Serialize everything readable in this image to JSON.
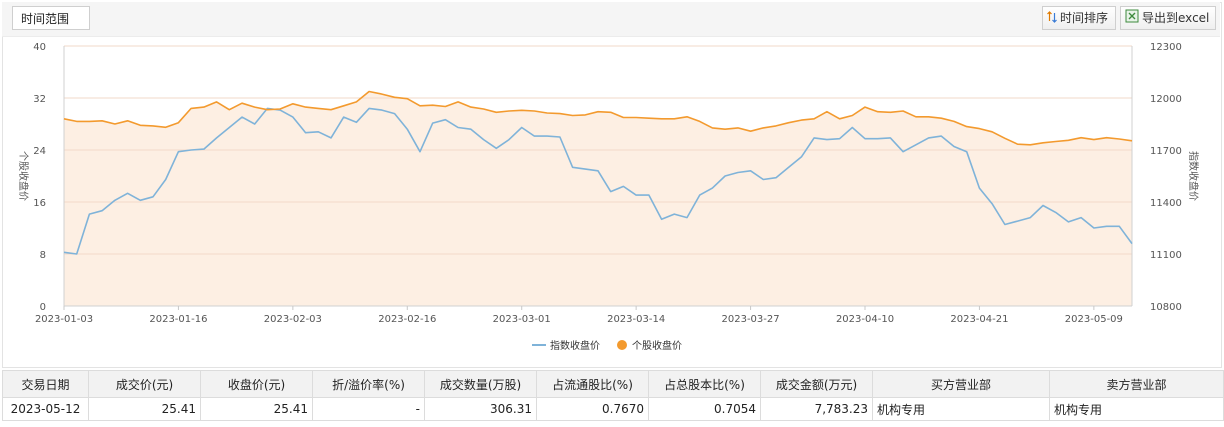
{
  "toolbar": {
    "range_label": "时间范围",
    "sort_label": "时间排序",
    "export_label": "导出到excel"
  },
  "chart_data": {
    "type": "line",
    "x": [
      "2023-01-03",
      "2023-01-04",
      "2023-01-05",
      "2023-01-06",
      "2023-01-09",
      "2023-01-10",
      "2023-01-11",
      "2023-01-12",
      "2023-01-13",
      "2023-01-16",
      "2023-01-17",
      "2023-01-18",
      "2023-01-19",
      "2023-01-20",
      "2023-01-30",
      "2023-01-31",
      "2023-02-01",
      "2023-02-02",
      "2023-02-03",
      "2023-02-06",
      "2023-02-07",
      "2023-02-08",
      "2023-02-09",
      "2023-02-10",
      "2023-02-13",
      "2023-02-14",
      "2023-02-15",
      "2023-02-16",
      "2023-02-17",
      "2023-02-20",
      "2023-02-21",
      "2023-02-22",
      "2023-02-23",
      "2023-02-24",
      "2023-02-27",
      "2023-02-28",
      "2023-03-01",
      "2023-03-02",
      "2023-03-03",
      "2023-03-06",
      "2023-03-07",
      "2023-03-08",
      "2023-03-09",
      "2023-03-10",
      "2023-03-13",
      "2023-03-14",
      "2023-03-15",
      "2023-03-16",
      "2023-03-17",
      "2023-03-20",
      "2023-03-21",
      "2023-03-22",
      "2023-03-23",
      "2023-03-24",
      "2023-03-27",
      "2023-03-28",
      "2023-03-29",
      "2023-03-30",
      "2023-03-31",
      "2023-04-03",
      "2023-04-04",
      "2023-04-06",
      "2023-04-07",
      "2023-04-10",
      "2023-04-11",
      "2023-04-12",
      "2023-04-13",
      "2023-04-14",
      "2023-04-17",
      "2023-04-18",
      "2023-04-19",
      "2023-04-20",
      "2023-04-21",
      "2023-04-24",
      "2023-04-25",
      "2023-04-26",
      "2023-04-27",
      "2023-04-28",
      "2023-05-04",
      "2023-05-05",
      "2023-05-08",
      "2023-05-09",
      "2023-05-10",
      "2023-05-11",
      "2023-05-12"
    ],
    "series": [
      {
        "name": "指数收盘价",
        "axis": "right",
        "color": "#7fb3d9",
        "values": [
          11110,
          11100,
          11330,
          11350,
          11410,
          11450,
          11410,
          11430,
          11530,
          11690,
          11700,
          11705,
          11770,
          11830,
          11890,
          11850,
          11940,
          11930,
          11890,
          11800,
          11805,
          11770,
          11890,
          11860,
          11940,
          11930,
          11910,
          11820,
          11690,
          11855,
          11875,
          11830,
          11820,
          11760,
          11710,
          11760,
          11830,
          11780,
          11780,
          11775,
          11600,
          11590,
          11580,
          11460,
          11490,
          11440,
          11440,
          11300,
          11330,
          11310,
          11440,
          11480,
          11550,
          11570,
          11580,
          11530,
          11540,
          11600,
          11660,
          11770,
          11760,
          11765,
          11830,
          11765,
          11765,
          11770,
          11690,
          11730,
          11770,
          11780,
          11720,
          11690,
          11480,
          11390,
          11270,
          11290,
          11310,
          11380,
          11340,
          11285,
          11310,
          11250,
          11260,
          11260,
          11160
        ]
      },
      {
        "name": "个股收盘价",
        "axis": "left",
        "color": "#f39a2e",
        "values": [
          28.8,
          28.4,
          28.4,
          28.5,
          28.0,
          28.5,
          27.8,
          27.7,
          27.5,
          28.2,
          30.4,
          30.6,
          31.4,
          30.2,
          31.2,
          30.6,
          30.2,
          30.3,
          31.1,
          30.6,
          30.4,
          30.2,
          30.8,
          31.4,
          33.0,
          32.6,
          32.1,
          31.9,
          30.8,
          30.9,
          30.7,
          31.4,
          30.6,
          30.3,
          29.8,
          30.0,
          30.1,
          30.0,
          29.7,
          29.6,
          29.3,
          29.4,
          29.9,
          29.8,
          29.0,
          29.0,
          28.9,
          28.8,
          28.8,
          29.1,
          28.4,
          27.4,
          27.2,
          27.4,
          26.9,
          27.4,
          27.7,
          28.2,
          28.6,
          28.8,
          29.9,
          28.8,
          29.3,
          30.6,
          29.9,
          29.8,
          30.0,
          29.1,
          29.1,
          28.9,
          28.4,
          27.6,
          27.3,
          26.8,
          25.8,
          24.9,
          24.8,
          25.1,
          25.3,
          25.5,
          25.9,
          25.6,
          25.9,
          25.7,
          25.41
        ]
      }
    ],
    "xticks": [
      "2023-01-03",
      "2023-01-16",
      "2023-02-03",
      "2023-02-16",
      "2023-03-01",
      "2023-03-14",
      "2023-03-27",
      "2023-04-10",
      "2023-04-21",
      "2023-05-09"
    ],
    "ylabel_left": "个股收盘价",
    "ylabel_right": "指数收盘价",
    "ylim_left": [
      0,
      40
    ],
    "ylim_right": [
      10800,
      12300
    ],
    "yticks_left": [
      "0",
      "8",
      "16",
      "24",
      "32",
      "40"
    ],
    "yticks_right": [
      "10800",
      "11100",
      "11400",
      "11700",
      "12000",
      "12300"
    ],
    "legend": [
      "指数收盘价",
      "个股收盘价"
    ],
    "legend_position": "bottom-center",
    "area_fill": "#fdefe3",
    "grid": true
  },
  "table": {
    "headers": [
      "交易日期",
      "成交价(元)",
      "收盘价(元)",
      "折/溢价率(%)",
      "成交数量(万股)",
      "占流通股比(%)",
      "占总股本比(%)",
      "成交金额(万元)",
      "买方营业部",
      "卖方营业部"
    ],
    "rows": [
      [
        "2023-05-12",
        "25.41",
        "25.41",
        "-",
        "306.31",
        "0.7670",
        "0.7054",
        "7,783.23",
        "机构专用",
        "机构专用"
      ]
    ]
  }
}
